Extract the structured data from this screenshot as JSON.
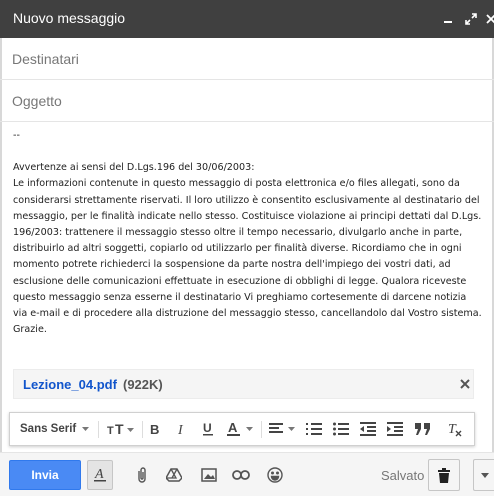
{
  "window": {
    "title": "Nuovo messaggio",
    "controls": [
      "minimize-icon",
      "expand-icon",
      "close-icon"
    ]
  },
  "recipients": {
    "placeholder": "Destinatari"
  },
  "subject": {
    "placeholder": "Oggetto"
  },
  "message": {
    "signature": "--",
    "disclaimer_title": "Avvertenze ai sensi del D.Lgs.196 del 30/06/2003:",
    "disclaimer_body": "Le informazioni contenute in questo messaggio di posta elettronica  e/o files allegati, sono da considerarsi strettamente riservati. Il loro utilizzo è consentito esclusivamente al destinatario del messaggio, per le finalità indicate nello stesso. Costituisce violazione ai principi dettati dal D.Lgs. 196/2003: trattenere il messaggio stesso oltre il tempo necessario, divulgarlo anche in parte, distribuirlo ad altri soggetti, copiarlo od utilizzarlo per finalità diverse. Ricordiamo che in ogni momento potrete richiederci la sospensione da parte nostra dell'impiego dei vostri dati, ad esclusione delle comunicazioni effettuate in esecuzione di obblighi di legge. Qualora riceveste questo messaggio senza esserne il destinatario Vi preghiamo cortesemente di darcene notizia via e-mail e di procedere alla distruzione del messaggio stesso, cancellandolo dal Vostro sistema. Grazie."
  },
  "attachment": {
    "filename": "Lezione_04.pdf",
    "size": "(922K)",
    "remove_icon": "close-icon"
  },
  "formatting": {
    "font": "Sans Serif",
    "tools": [
      "font-size-icon",
      "bold-icon",
      "italic-icon",
      "underline-icon",
      "text-color-icon",
      "align-icon",
      "numbered-list-icon",
      "bulleted-list-icon",
      "indent-less-icon",
      "indent-more-icon",
      "quote-icon",
      "remove-formatting-icon"
    ]
  },
  "bottom": {
    "send_label": "Invia",
    "saved_label": "Salvato",
    "tools": [
      "formatting-toggle-icon",
      "attach-icon",
      "drive-icon",
      "photo-icon",
      "link-icon",
      "emoji-icon",
      "trash-icon",
      "more-options-icon"
    ]
  },
  "colors": {
    "titlebar": "#404040",
    "send_button": "#4a8af4",
    "attachment_link": "#1155cc"
  }
}
